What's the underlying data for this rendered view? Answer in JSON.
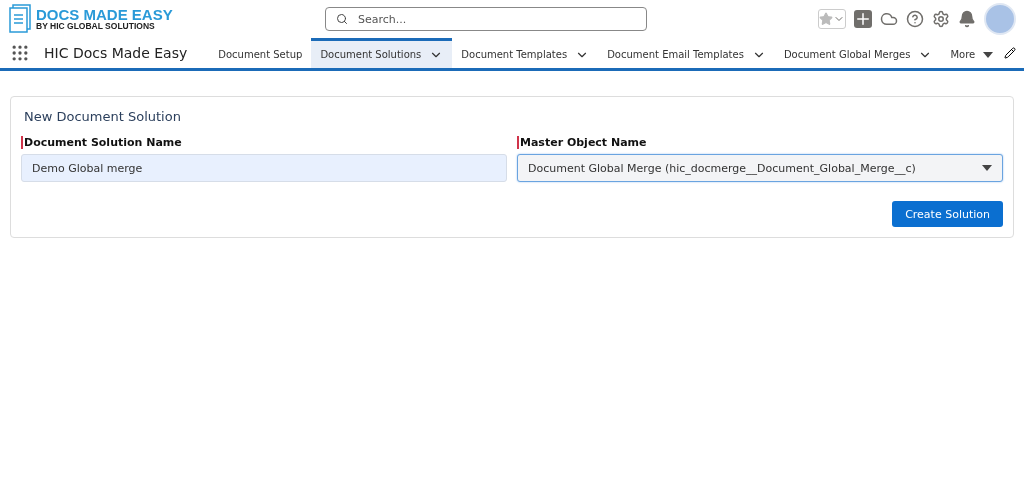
{
  "logo": {
    "title": "DOCS MADE EASY",
    "subtitle": "BY HIC GLOBAL SOLUTIONS"
  },
  "search": {
    "placeholder": "Search..."
  },
  "app_name": "HIC Docs Made Easy",
  "tabs": [
    {
      "label": "Document Setup",
      "selected": false,
      "menu": false
    },
    {
      "label": "Document Solutions",
      "selected": true,
      "menu": true
    },
    {
      "label": "Document Templates",
      "selected": false,
      "menu": true
    },
    {
      "label": "Document Email Templates",
      "selected": false,
      "menu": true
    },
    {
      "label": "Document Global Merges",
      "selected": false,
      "menu": true
    }
  ],
  "more": "More",
  "form": {
    "title": "New Document Solution",
    "fields": [
      {
        "kind": "text",
        "label": "Document Solution Name",
        "value": "Demo Global merge",
        "required": true
      },
      {
        "kind": "select",
        "label": "Master Object Name",
        "value": "Document Global Merge (hic_docmerge__Document_Global_Merge__c)",
        "required": true
      }
    ],
    "button": "Create Solution"
  }
}
